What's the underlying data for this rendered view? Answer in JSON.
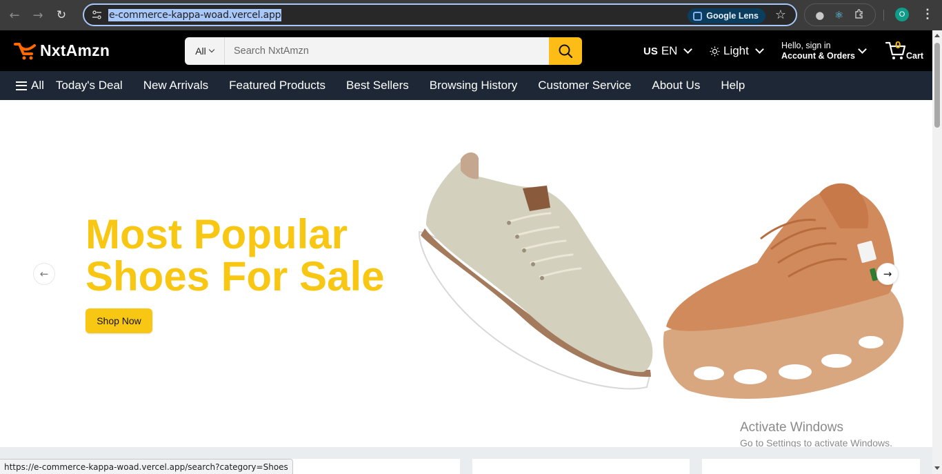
{
  "browser": {
    "url": "e-commerce-kappa-woad.vercel.app",
    "lens_label": "Google Lens",
    "profile_initial": "O",
    "status_url": "https://e-commerce-kappa-woad.vercel.app/search?category=Shoes"
  },
  "header": {
    "logo_text": "NxtAmzn",
    "search": {
      "category": "All",
      "placeholder": "Search NxtAmzn"
    },
    "language": {
      "flag": "US",
      "label": "EN"
    },
    "theme": {
      "label": "Light"
    },
    "account": {
      "greeting": "Hello, sign in",
      "label": "Account & Orders"
    },
    "cart": {
      "count": "0",
      "label": "Cart"
    }
  },
  "subnav": {
    "all_label": "All",
    "links": [
      "Today's Deal",
      "New Arrivals",
      "Featured Products",
      "Best Sellers",
      "Browsing History",
      "Customer Service",
      "About Us",
      "Help"
    ]
  },
  "hero": {
    "title_line1": "Most Popular",
    "title_line2": "Shoes For Sale",
    "button_label": "Shop Now"
  },
  "watermark": {
    "line1": "Activate Windows",
    "line2": "Go to Settings to activate Windows."
  },
  "colors": {
    "accent": "#febd16",
    "hero_text": "#f8c713",
    "header_bg": "#000000",
    "subnav_bg": "#1e2736",
    "logo_orange": "#ff6a00"
  }
}
